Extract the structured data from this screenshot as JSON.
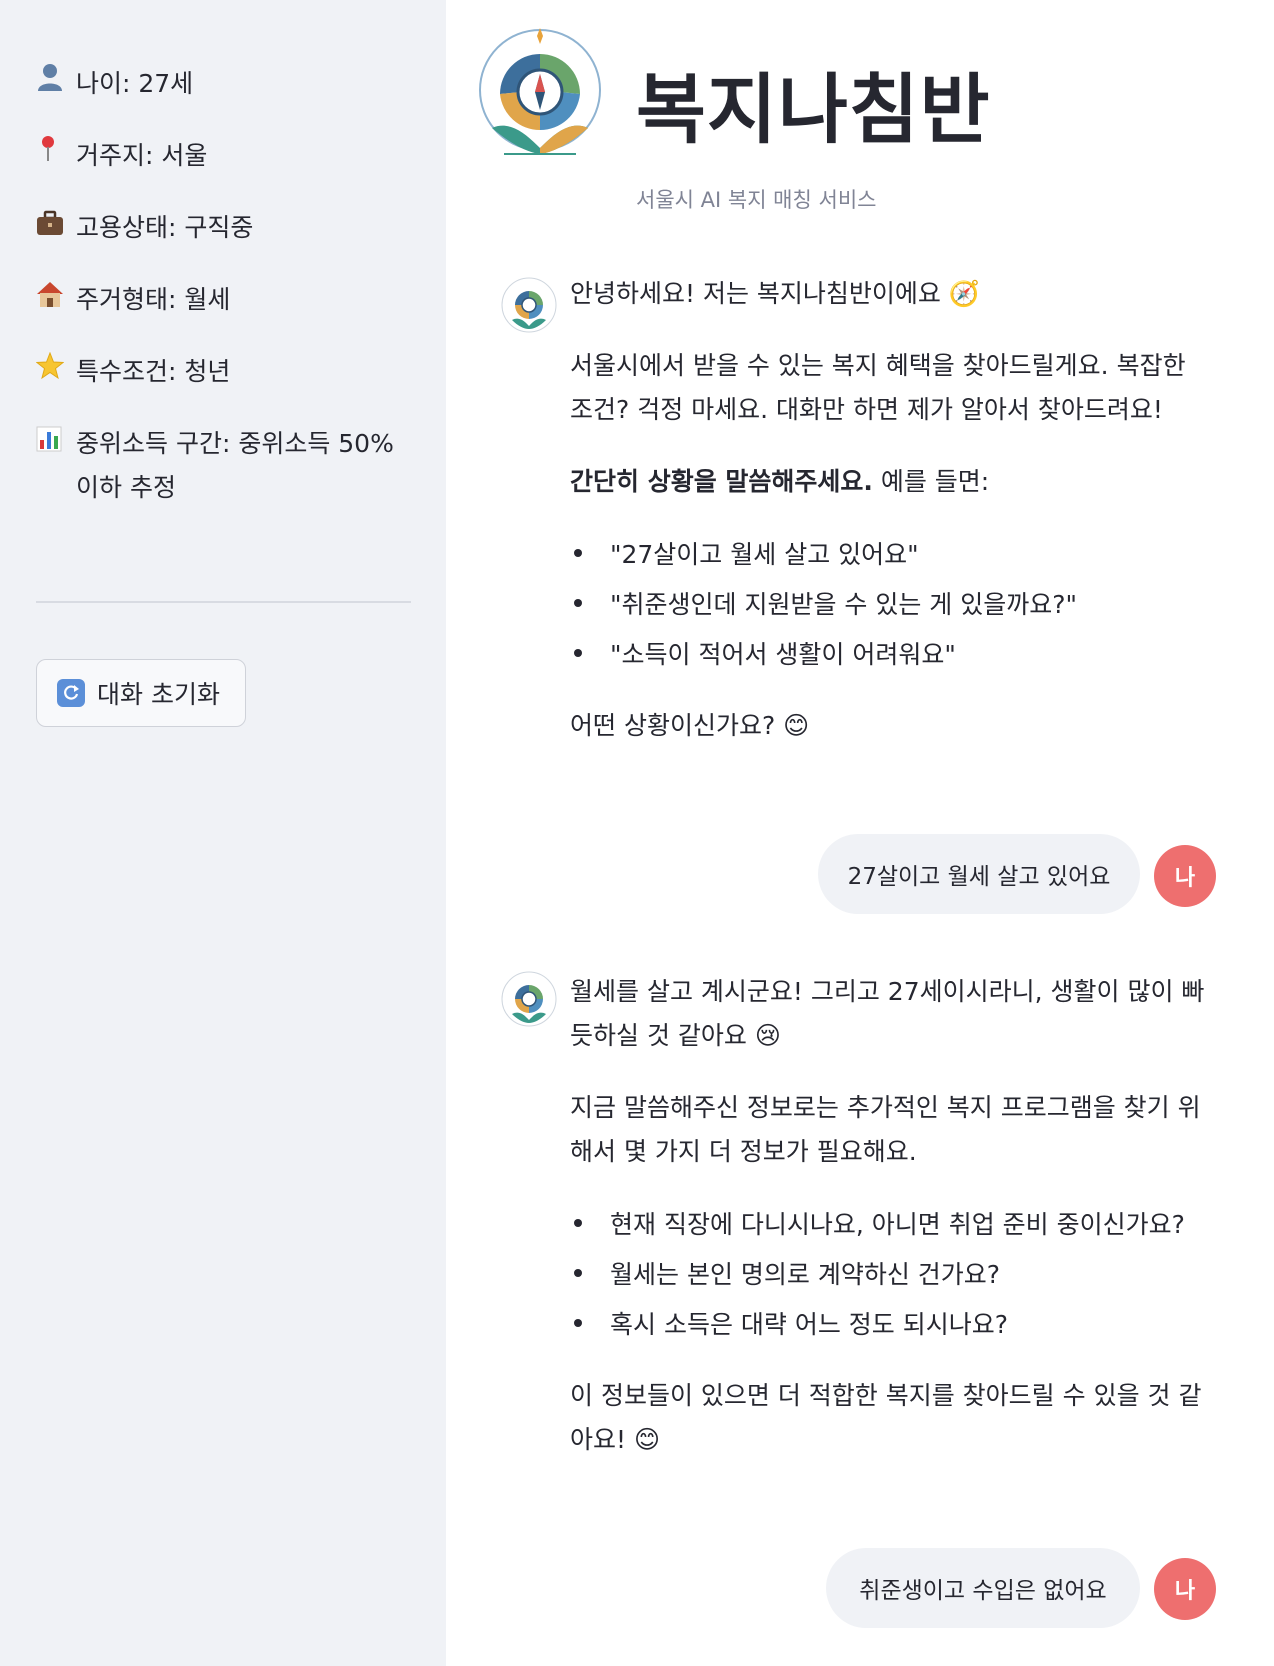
{
  "sidebar": {
    "items": [
      {
        "icon": "person-icon",
        "text": "나이: 27세"
      },
      {
        "icon": "pin-icon",
        "text": "거주지: 서울"
      },
      {
        "icon": "briefcase-icon",
        "text": "고용상태: 구직중"
      },
      {
        "icon": "house-icon",
        "text": "주거형태: 월세"
      },
      {
        "icon": "star-icon",
        "text": "특수조건: 청년"
      },
      {
        "icon": "bar-chart-icon",
        "text": "중위소득 구간: 중위소득 50% 이하 추정"
      }
    ],
    "reset_label": "대화 초기화"
  },
  "header": {
    "title": "복지나침반",
    "subtitle": "서울시 AI 복지 매칭 서비스"
  },
  "chat": {
    "m1": {
      "greeting": "안녕하세요! 저는 복지나침반이에요 🧭",
      "p2": "서울시에서 받을 수 있는 복지 혜택을 찾아드릴게요. 복잡한 조건? 걱정 마세요. 대화만 하면 제가 알아서 찾아드려요!",
      "p3_bold": "간단히 상황을 말씀해주세요.",
      "p3_rest": " 예를 들면:",
      "list": [
        "\"27살이고 월세 살고 있어요\"",
        "\"취준생인데 지원받을 수 있는 게 있을까요?\"",
        "\"소득이 적어서 생활이 어려워요\""
      ],
      "closing": "어떤 상황이신가요? 😊"
    },
    "u1": "27살이고 월세 살고 있어요",
    "m2": {
      "p1": "월세를 살고 계시군요! 그리고 27세이시라니, 생활이 많이 빠듯하실 것 같아요 😢",
      "p2": "지금 말씀해주신 정보로는 추가적인 복지 프로그램을 찾기 위해서 몇 가지 더 정보가 필요해요.",
      "list": [
        "현재 직장에 다니시나요, 아니면 취업 준비 중이신가요?",
        "월세는 본인 명의로 계약하신 건가요?",
        "혹시 소득은 대략 어느 정도 되시나요?"
      ],
      "closing": "이 정보들이 있으면 더 적합한 복지를 찾아드릴 수 있을 것 같아요! 😊"
    },
    "u2": "취준생이고 수입은 없어요",
    "user_avatar": "나"
  },
  "colors": {
    "accent": "#ee6f6f",
    "sidebar_bg": "#f0f2f6",
    "bubble_bg": "#f0f2f6"
  }
}
